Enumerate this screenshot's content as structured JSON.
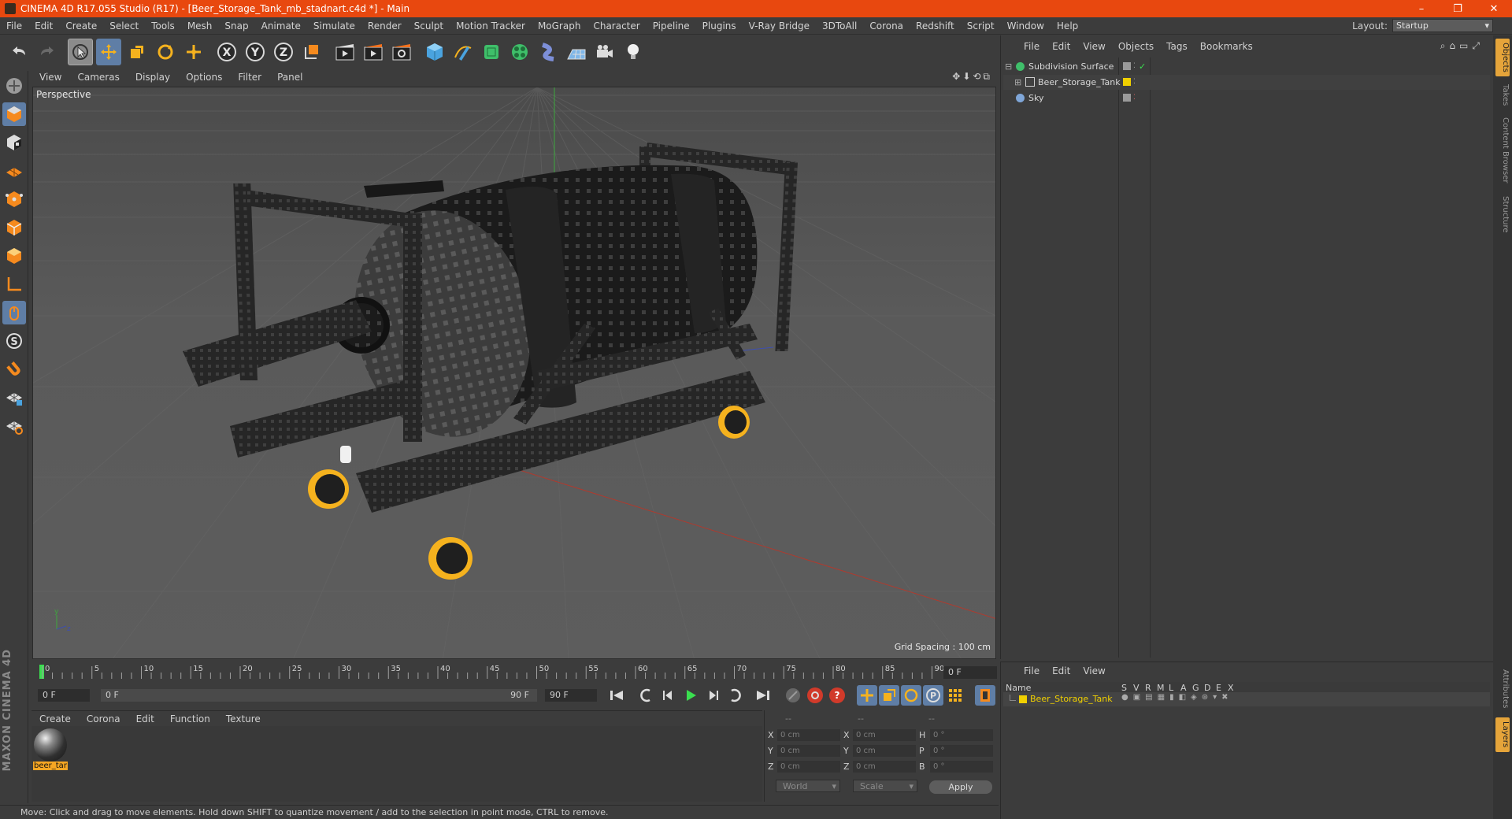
{
  "window": {
    "title": "CINEMA 4D R17.055 Studio (R17) - [Beer_Storage_Tank_mb_stadnart.c4d *] - Main",
    "minimize": "–",
    "restore": "❐",
    "close": "✕"
  },
  "menubar": {
    "items": [
      "File",
      "Edit",
      "Create",
      "Select",
      "Tools",
      "Mesh",
      "Snap",
      "Animate",
      "Simulate",
      "Render",
      "Sculpt",
      "Motion Tracker",
      "MoGraph",
      "Character",
      "Pipeline",
      "Plugins",
      "V-Ray Bridge",
      "3DToAll",
      "Corona",
      "Redshift",
      "Script",
      "Window",
      "Help"
    ],
    "layout_label": "Layout:",
    "layout_value": "Startup"
  },
  "toolbar": {
    "axis_x": "X",
    "axis_y": "Y",
    "axis_z": "Z"
  },
  "viewport": {
    "menu": [
      "View",
      "Cameras",
      "Display",
      "Options",
      "Filter",
      "Panel"
    ],
    "label": "Perspective",
    "grid_spacing": "Grid Spacing : 100 cm",
    "nav_icons": "✥⬇⟲⧉"
  },
  "timeline": {
    "ticks": [
      "0",
      "5",
      "10",
      "15",
      "20",
      "25",
      "30",
      "35",
      "40",
      "45",
      "50",
      "55",
      "60",
      "65",
      "70",
      "75",
      "80",
      "85",
      "90"
    ],
    "current_frame": "0 F",
    "start_field": "0 F",
    "range_start": "0 F",
    "range_end": "90 F",
    "end_field": "90 F"
  },
  "material_manager": {
    "menu": [
      "Create",
      "Corona",
      "Edit",
      "Function",
      "Texture"
    ],
    "material_label": "beer_tar"
  },
  "coordinates": {
    "header_cols": [
      "--",
      "--",
      "--"
    ],
    "rows": [
      {
        "a": "X",
        "av": "0 cm",
        "b": "X",
        "bv": "0 cm",
        "c": "H",
        "cv": "0 °"
      },
      {
        "a": "Y",
        "av": "0 cm",
        "b": "Y",
        "bv": "0 cm",
        "c": "P",
        "cv": "0 °"
      },
      {
        "a": "Z",
        "av": "0 cm",
        "b": "Z",
        "bv": "0 cm",
        "c": "B",
        "cv": "0 °"
      }
    ],
    "mode1": "World",
    "mode2": "Scale",
    "apply": "Apply"
  },
  "status": "Move: Click and drag to move elements. Hold down SHIFT to quantize movement / add to the selection in point mode, CTRL to remove.",
  "object_manager": {
    "menu": [
      "File",
      "Edit",
      "View",
      "Objects",
      "Tags",
      "Bookmarks"
    ],
    "objects": [
      {
        "name": "Subdivision Surface",
        "icon_color": "#3fbf6a"
      },
      {
        "name": "Beer_Storage_Tank",
        "icon_color": "#cfcfcf",
        "tag_color": "#f0d000"
      },
      {
        "name": "Sky",
        "icon_color": "#7fa6d8"
      }
    ]
  },
  "layers": {
    "menu": [
      "File",
      "Edit",
      "View"
    ],
    "columns": [
      "Name",
      "S",
      "V",
      "R",
      "M",
      "L",
      "A",
      "G",
      "D",
      "E",
      "X"
    ],
    "row_name": "Beer_Storage_Tank",
    "row_color": "#f0d000"
  },
  "right_tabs": [
    "Objects",
    "Takes",
    "Content Browser",
    "Structure",
    "Attributes",
    "Layers"
  ],
  "colors": {
    "titlebar": "#e8480f",
    "selection_blue": "#5f7ea6",
    "accent_orange": "#f6a623"
  },
  "branding": "MAXON CINEMA 4D"
}
